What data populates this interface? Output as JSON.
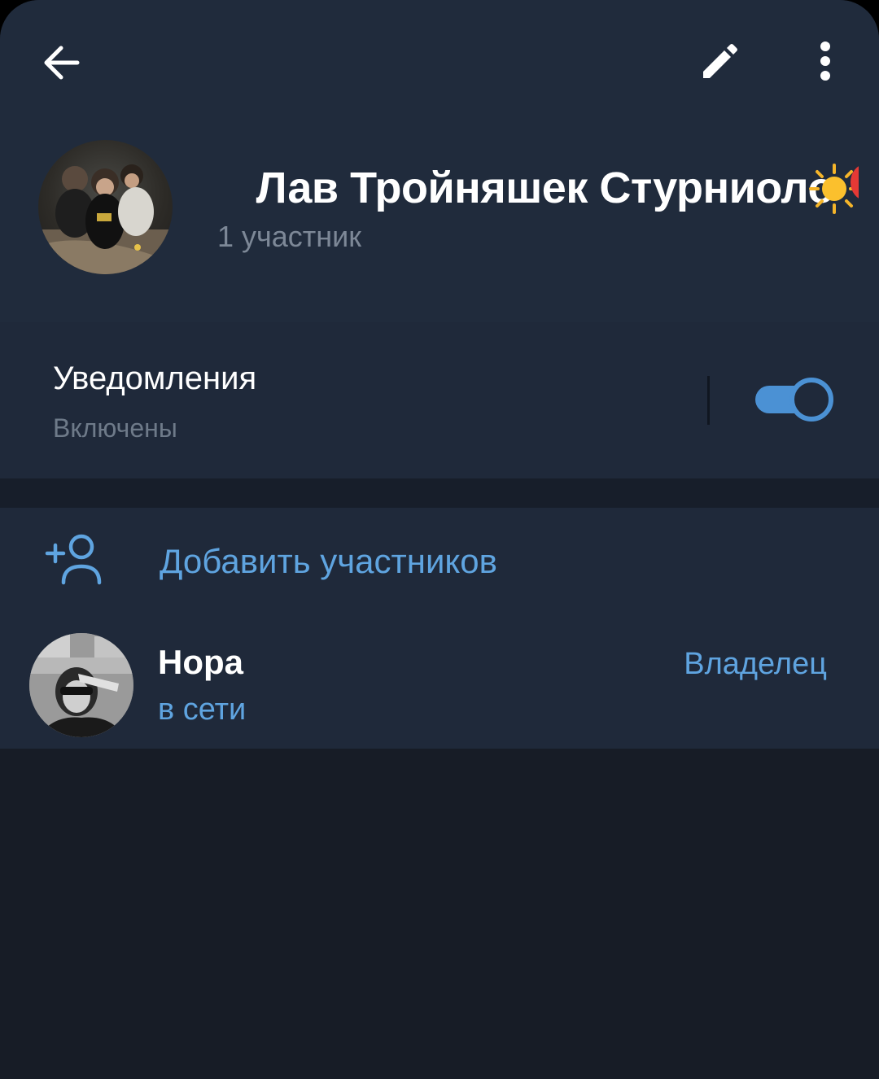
{
  "header": {
    "back_icon": "arrow-left-icon",
    "edit_icon": "pencil-icon",
    "more_icon": "more-vertical-icon",
    "group_title": "Лав Тройняшек Стурниоло",
    "title_emojis": [
      "sun-emoji",
      "balloon-emoji"
    ],
    "subtitle": "1 участник"
  },
  "notifications": {
    "title": "Уведомления",
    "status": "Включены",
    "enabled": true
  },
  "members": {
    "add_icon": "add-user-icon",
    "add_label": "Добавить участников",
    "list": [
      {
        "name": "Нора",
        "status": "в сети",
        "role": "Владелец"
      }
    ]
  },
  "colors": {
    "header_bg": "#202b3c",
    "section_bg": "#1f293a",
    "screen_bg": "#171c26",
    "accent": "#5fa4e0",
    "toggle": "#4b91d4",
    "muted": "#7d8897"
  }
}
